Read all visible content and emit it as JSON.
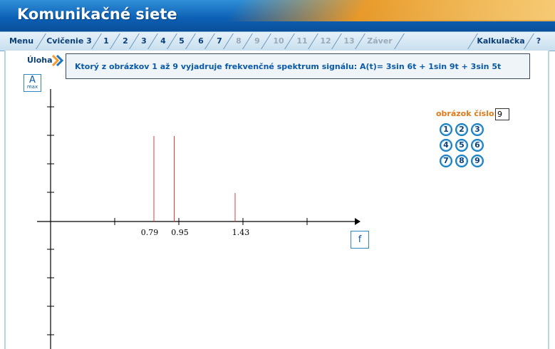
{
  "app": {
    "title": "Komunikačné siete"
  },
  "nav": {
    "items": [
      {
        "label": "Menu",
        "enabled": true
      },
      {
        "label": "Cvičenie 3",
        "enabled": true
      },
      {
        "label": "1",
        "enabled": true
      },
      {
        "label": "2",
        "enabled": true
      },
      {
        "label": "3",
        "enabled": true
      },
      {
        "label": "4",
        "enabled": true
      },
      {
        "label": "5",
        "enabled": true
      },
      {
        "label": "6",
        "enabled": true
      },
      {
        "label": "7",
        "enabled": true
      },
      {
        "label": "8",
        "enabled": false
      },
      {
        "label": "9",
        "enabled": false
      },
      {
        "label": "10",
        "enabled": false
      },
      {
        "label": "11",
        "enabled": false
      },
      {
        "label": "12",
        "enabled": false
      },
      {
        "label": "13",
        "enabled": false
      },
      {
        "label": "Záver",
        "enabled": false
      }
    ],
    "calculator": "Kalkulačka",
    "help": "?"
  },
  "task": {
    "label": "Úloha",
    "text": "Ktorý z obrázkov 1 až 9 vyjadruje frekvenčné spektrum signálu: A(t)= 3sin 6t  + 1sin 9t  + 3sin 5t"
  },
  "axes": {
    "y_button_main": "A",
    "y_button_sub": "max",
    "x_button": "f"
  },
  "selector": {
    "label": "obrázok číslo:",
    "value": "9",
    "buttons": [
      "1",
      "2",
      "3",
      "4",
      "5",
      "6",
      "7",
      "8",
      "9"
    ]
  },
  "chart_data": {
    "type": "bar",
    "x_tick_labels": [
      "0.79",
      "0.95",
      "1.43"
    ],
    "x": [
      0.79,
      0.95,
      1.43
    ],
    "values": [
      3,
      3,
      1
    ],
    "line_color": "#e23b3b"
  },
  "colors": {
    "header_blue": "#0c5fb4",
    "accent_orange": "#ff9f1a",
    "text_blue": "#0a5aa8",
    "label_orange": "#e07a1a"
  }
}
